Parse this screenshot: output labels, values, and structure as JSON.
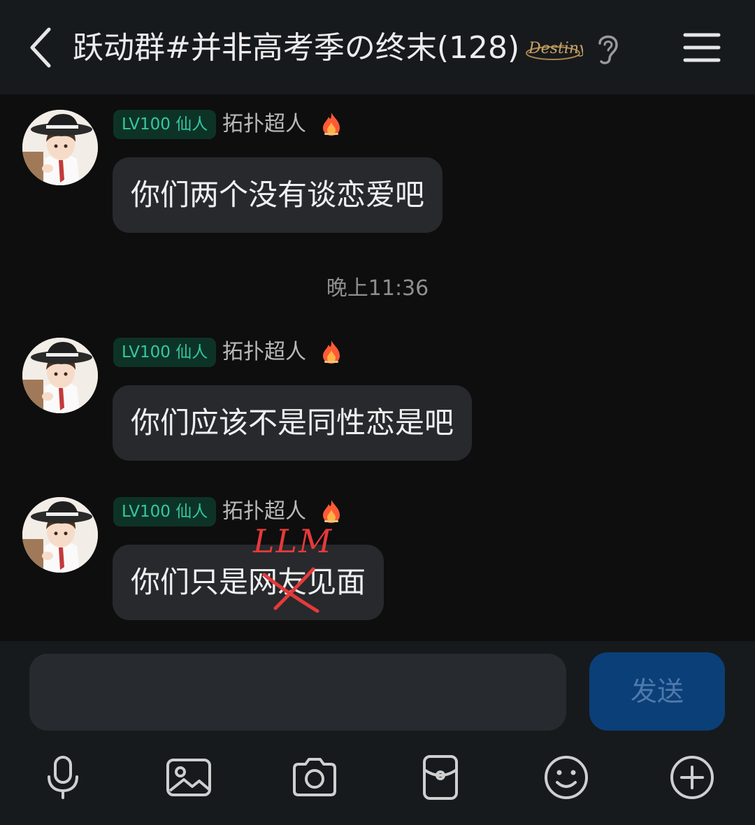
{
  "header": {
    "back_icon": "chevron-left-icon",
    "title": "跃动群#并非高考季の终末(128)",
    "badge_icon": "destiny-badge-icon",
    "badge_text": "Destiny",
    "ear_icon": "ear-icon",
    "menu_icon": "hamburger-menu-icon"
  },
  "messages": [
    {
      "level": "LV100 仙人",
      "sender": "拓扑超人",
      "text": "你们两个没有谈恋爱吧"
    },
    {
      "level": "LV100 仙人",
      "sender": "拓扑超人",
      "text": "你们应该不是同性恋是吧"
    },
    {
      "level": "LV100 仙人",
      "sender": "拓扑超人",
      "text": "你们只是网友见面"
    }
  ],
  "timestamp": "晚上11:36",
  "annotation": {
    "text": "LLM",
    "color": "#e53a3a"
  },
  "input": {
    "placeholder": "",
    "send_label": "发送"
  },
  "toolbar": [
    {
      "icon": "microphone-icon"
    },
    {
      "icon": "image-icon"
    },
    {
      "icon": "camera-icon"
    },
    {
      "icon": "red-packet-icon"
    },
    {
      "icon": "emoji-icon"
    },
    {
      "icon": "plus-icon"
    }
  ],
  "colors": {
    "background": "#0e0e0e",
    "header": "#161a1d",
    "bubble": "#27292d",
    "level_tag_bg": "#0d3327",
    "level_tag_text": "#35c9a0",
    "send_button": "#0b3f78"
  }
}
